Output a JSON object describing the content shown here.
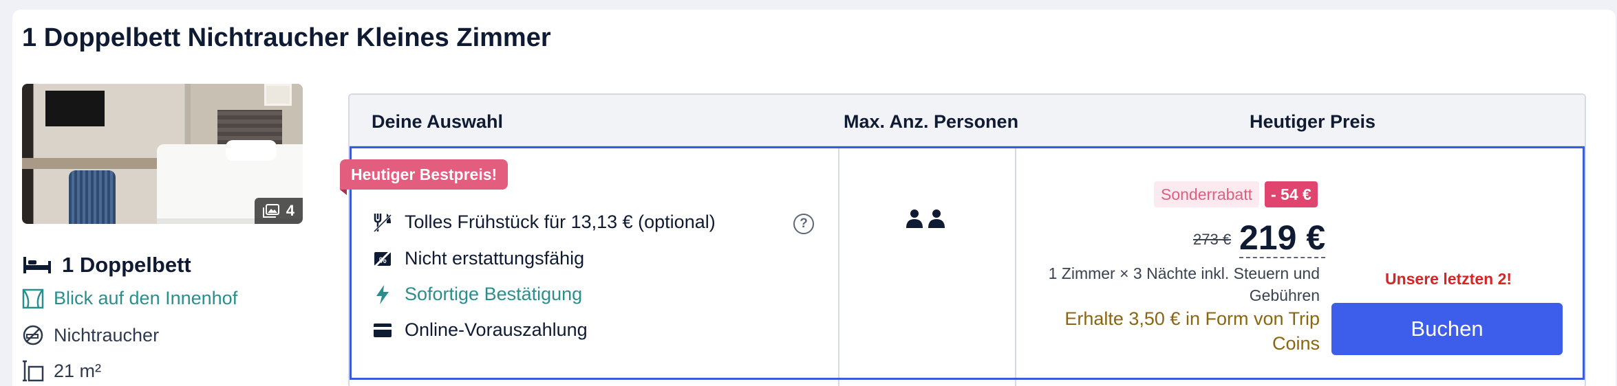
{
  "room": {
    "title": "1 Doppelbett Nichtraucher Kleines Zimmer",
    "photo_count": "4",
    "features": {
      "bed": "1 Doppelbett",
      "view": "Blick auf den Innenhof",
      "smoking": "Nichtraucher",
      "size": "21 m²"
    }
  },
  "table": {
    "headers": [
      "Deine Auswahl",
      "Max. Anz. Personen",
      "Heutiger Preis"
    ],
    "best_price_tag": "Heutiger Bestpreis!",
    "options": [
      {
        "icon": "cutlery-icon",
        "label": "Tolles Frühstück für 13,13 € (optional)"
      },
      {
        "icon": "no-refund-icon",
        "label": "Nicht erstattungsfähig"
      },
      {
        "icon": "lightning-icon",
        "label": "Sofortige Bestätigung"
      },
      {
        "icon": "card-icon",
        "label": "Online-Vorauszahlung"
      }
    ],
    "help_symbol": "?",
    "max_persons": 2
  },
  "price": {
    "discount_label": "Sonderrabatt",
    "discount_value": "- 54 €",
    "old_price": "273 €",
    "new_price": "219 €",
    "note": "1 Zimmer × 3 Nächte inkl. Steuern und Gebühren",
    "coins": "Erhalte 3,50 € in Form von Trip Coins",
    "last_rooms": "Unsere letzten 2!",
    "book_label": "Buchen"
  },
  "colors": {
    "accent_blue": "#3d5eea",
    "teal": "#2a8f8c",
    "pink": "#e35d7f",
    "alert_red": "#d52525",
    "coins_gold": "#8b6510"
  }
}
